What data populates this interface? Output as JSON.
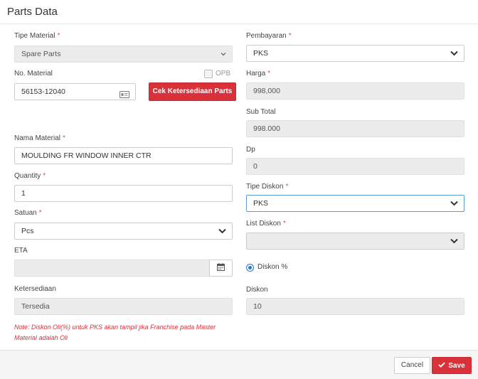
{
  "modal": {
    "title": "Parts Data"
  },
  "required_mark": "*",
  "left": {
    "tipe_material": {
      "label": "Tipe Material",
      "value": "Spare Parts"
    },
    "no_material": {
      "label": "No. Material",
      "value": "56153-12040",
      "opb_label": "OPB",
      "opb_checked": false
    },
    "cek_button": "Cek Ketersediaan Parts",
    "nama_material": {
      "label": "Nama Material",
      "value": "MOULDING FR WINDOW INNER CTR"
    },
    "quantity": {
      "label": "Quantity",
      "value": "1"
    },
    "satuan": {
      "label": "Satuan",
      "value": "Pcs"
    },
    "eta": {
      "label": "ETA",
      "value": ""
    },
    "ketersediaan": {
      "label": "Ketersediaan",
      "value": "Tersedia"
    },
    "note": "Note: Diskon Oli(%) untuk PKS akan tampil jika Franchise pada Master Material adalah Oli"
  },
  "right": {
    "pembayaran": {
      "label": "Pembayaran",
      "value": "PKS"
    },
    "harga": {
      "label": "Harga",
      "value": "998,000"
    },
    "sub_total": {
      "label": "Sub Total",
      "value": "998.000"
    },
    "dp": {
      "label": "Dp",
      "value": "0"
    },
    "tipe_diskon": {
      "label": "Tipe Diskon",
      "value": "PKS"
    },
    "list_diskon": {
      "label": "List Diskon",
      "value": ""
    },
    "diskon_radio": {
      "label": "Diskon %",
      "selected": true
    },
    "diskon": {
      "label": "Diskon",
      "value": "10"
    }
  },
  "footer": {
    "cancel_label": "Cancel",
    "save_label": "Save"
  },
  "colors": {
    "primary_red": "#d9313a",
    "focus_blue": "#5b9bd5",
    "radio_blue": "#2b73d4"
  },
  "icons": [
    "chevron-down-icon",
    "id-card-icon",
    "calendar-icon",
    "check-icon"
  ]
}
